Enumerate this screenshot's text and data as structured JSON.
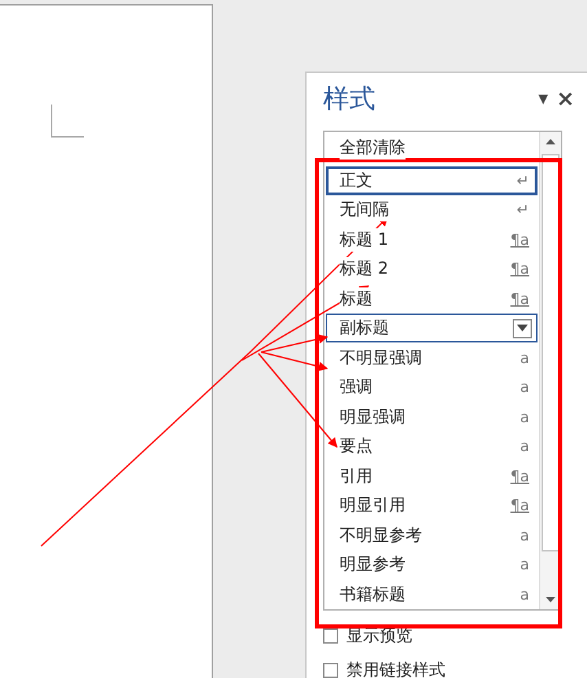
{
  "pane": {
    "title": "样式",
    "menu_glyph": "▾",
    "close_glyph": "×"
  },
  "styles": [
    {
      "label": "全部清除",
      "kind": "clear",
      "selected": false,
      "hovered": false
    },
    {
      "label": "正文",
      "kind": "paragraph",
      "symbol": "↵",
      "selected": true,
      "hovered": false
    },
    {
      "label": "无间隔",
      "kind": "paragraph",
      "symbol": "↵",
      "selected": false,
      "hovered": false
    },
    {
      "label": "标题 1",
      "kind": "linked",
      "symbol": "¶a",
      "selected": false,
      "hovered": false
    },
    {
      "label": "标题 2",
      "kind": "linked",
      "symbol": "¶a",
      "selected": false,
      "hovered": false
    },
    {
      "label": "标题",
      "kind": "linked",
      "symbol": "¶a",
      "selected": false,
      "hovered": false
    },
    {
      "label": "副标题",
      "kind": "linked",
      "selected": false,
      "hovered": true
    },
    {
      "label": "不明显强调",
      "kind": "character",
      "symbol": "a",
      "selected": false,
      "hovered": false
    },
    {
      "label": "强调",
      "kind": "character",
      "symbol": "a",
      "selected": false,
      "hovered": false
    },
    {
      "label": "明显强调",
      "kind": "character",
      "symbol": "a",
      "selected": false,
      "hovered": false
    },
    {
      "label": "要点",
      "kind": "character",
      "symbol": "a",
      "selected": false,
      "hovered": false
    },
    {
      "label": "引用",
      "kind": "linked",
      "symbol": "¶a",
      "selected": false,
      "hovered": false
    },
    {
      "label": "明显引用",
      "kind": "linked",
      "symbol": "¶a",
      "selected": false,
      "hovered": false
    },
    {
      "label": "不明显参考",
      "kind": "character",
      "symbol": "a",
      "selected": false,
      "hovered": false
    },
    {
      "label": "明显参考",
      "kind": "character",
      "symbol": "a",
      "selected": false,
      "hovered": false
    },
    {
      "label": "书籍标题",
      "kind": "character",
      "symbol": "a",
      "selected": false,
      "hovered": false
    }
  ],
  "options": [
    {
      "label": "显示预览",
      "checked": false
    },
    {
      "label": "禁用链接样式",
      "checked": false
    }
  ]
}
